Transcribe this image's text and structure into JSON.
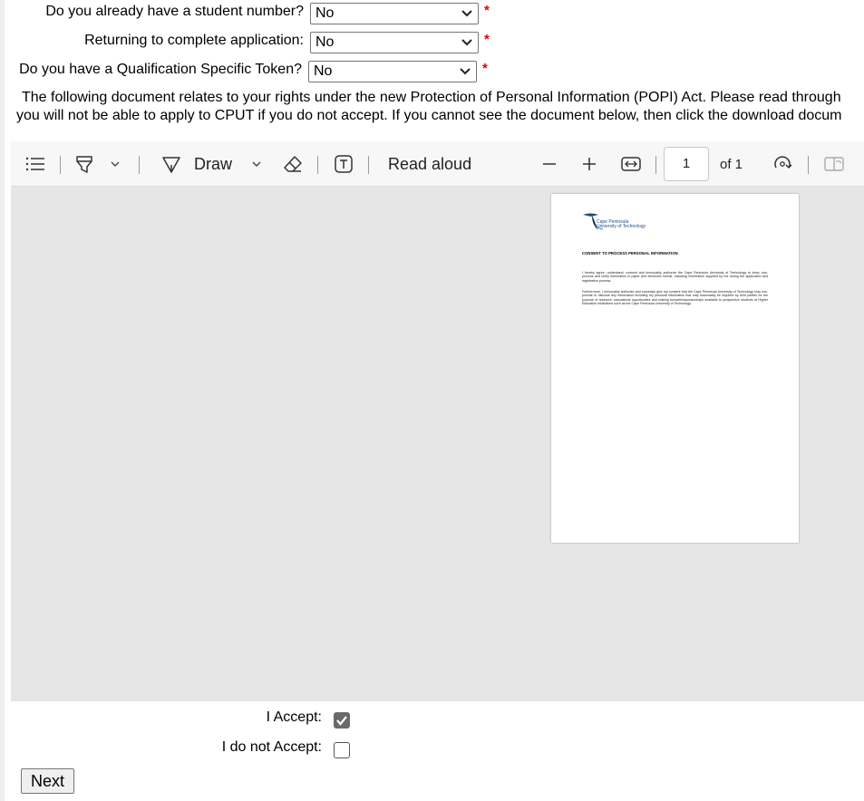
{
  "form": {
    "student_number": {
      "label": "Do you already have a student number?",
      "value": "No"
    },
    "returning": {
      "label": "Returning to complete application:",
      "value": "No"
    },
    "token": {
      "label": "Do you have a Qualification Specific Token?",
      "value": "No"
    },
    "required_mark": "*"
  },
  "popi": {
    "line1": "The following document relates to your rights under the new Protection of Personal Information (POPI) Act. Please read through",
    "line2": "you will not be able to apply to CPUT if you do not accept. If you cannot see the document below, then click the download docum"
  },
  "viewer": {
    "toolbar": {
      "draw_label": "Draw",
      "read_aloud_label": "Read aloud",
      "page_number": "1",
      "page_total": "of 1"
    },
    "document": {
      "logo_line1": "Cape Peninsula",
      "logo_line2": "University of Technology",
      "title": "CONSENT TO PROCESS PERSONAL INFORMATION",
      "para1": "I hereby agree, understand, consent and irrevocably authorize the Cape Peninsula University of Technology to keep, use, process and verify information in paper and electronic format, including information supplied by me during the application and registration process.",
      "para2": "Furthermore, I irrevocably authorise and expressly give my consent that the Cape Peninsula University of Technology may use, provide or disclose any information including my personal information that may reasonably be required by third parties for the purpose of research, educational opportunities and making bursaries/sponsorships available to prospective students at Higher Education Institutions such as the Cape Peninsula University of Technology."
    }
  },
  "consent": {
    "accept_label": "I Accept:",
    "accept_checked": true,
    "decline_label": "I do not Accept:",
    "decline_checked": false
  },
  "next_label": "Next",
  "colors": {
    "required": "#e00000",
    "viewer_bg": "#e6e6e6",
    "toolbar_bg": "#f7f7f7"
  }
}
